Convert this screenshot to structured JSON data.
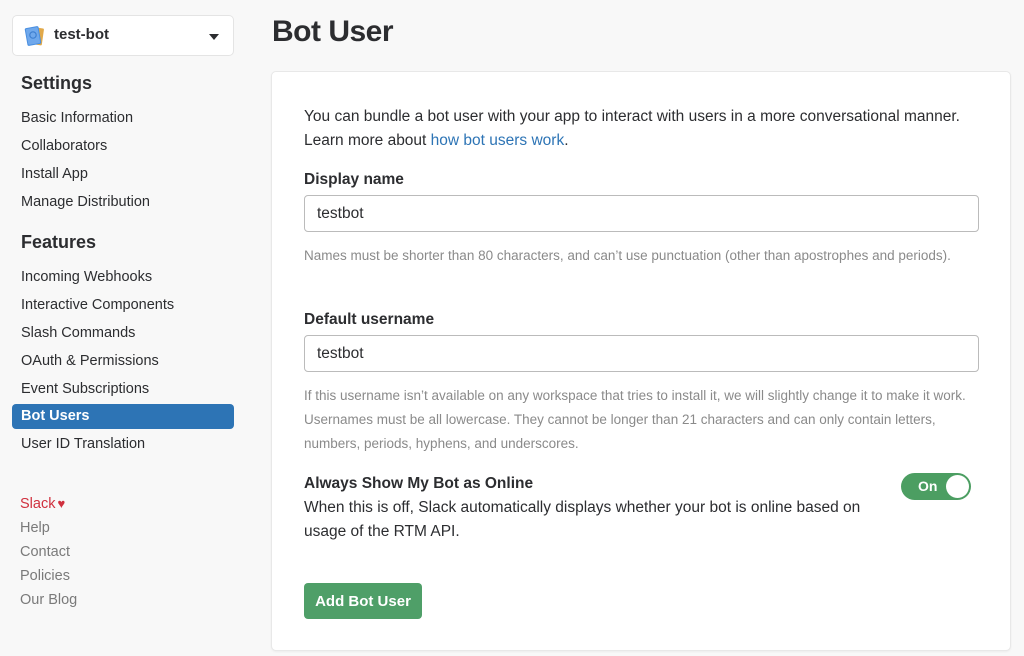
{
  "app_switcher": {
    "app_name": "test-bot",
    "icon": "app-book-icon"
  },
  "sidebar": {
    "settings_title": "Settings",
    "settings_items": [
      {
        "label": "Basic Information"
      },
      {
        "label": "Collaborators"
      },
      {
        "label": "Install App"
      },
      {
        "label": "Manage Distribution"
      }
    ],
    "features_title": "Features",
    "features_items": [
      {
        "label": "Incoming Webhooks"
      },
      {
        "label": "Interactive Components"
      },
      {
        "label": "Slash Commands"
      },
      {
        "label": "OAuth & Permissions"
      },
      {
        "label": "Event Subscriptions"
      },
      {
        "label": "Bot Users",
        "active": true
      },
      {
        "label": "User ID Translation"
      }
    ],
    "footer_links": [
      {
        "label": "Slack",
        "icon": "heart-icon"
      },
      {
        "label": "Help"
      },
      {
        "label": "Contact"
      },
      {
        "label": "Policies"
      },
      {
        "label": "Our Blog"
      }
    ]
  },
  "colors": {
    "accent_blue": "#2d74b5",
    "success_green": "#4f9f68",
    "slack_red": "#d0303e"
  },
  "main": {
    "title": "Bot User",
    "intro_text": "You can bundle a bot user with your app to interact with users in a more conversational manner. Learn more about ",
    "intro_link": "how bot users work",
    "intro_end": ".",
    "display_name": {
      "label": "Display name",
      "value": "testbot",
      "hint": "Names must be shorter than 80 characters, and can’t use punctuation (other than apostrophes and periods)."
    },
    "default_username": {
      "label": "Default username",
      "value": "testbot",
      "hint": "If this username isn’t available on any workspace that tries to install it, we will slightly change it to make it work. Usernames must be all lowercase. They cannot be longer than 21 characters and can only contain letters, numbers, periods, hyphens, and underscores."
    },
    "online_toggle": {
      "title": "Always Show My Bot as Online",
      "description": "When this is off, Slack automatically displays whether your bot is online based on usage of the RTM API.",
      "state_label": "On",
      "checked": true
    },
    "submit_label": "Add Bot User"
  }
}
